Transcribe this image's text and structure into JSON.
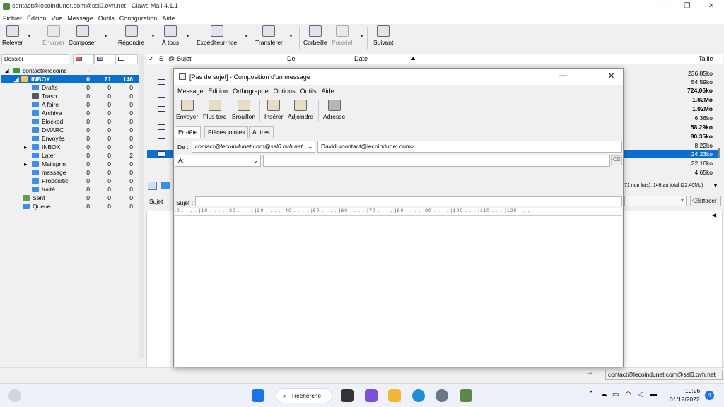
{
  "window": {
    "title": "contact@lecoindunet.com@ssl0.ovh.net - Claws Mail 4.1.1"
  },
  "menubar": [
    "Fichier",
    "Édition",
    "Vue",
    "Message",
    "Outils",
    "Configuration",
    "Aide"
  ],
  "toolbar": {
    "relever": "Relever",
    "envoyer": "Envoyer",
    "composer": "Composer",
    "repondre": "Répondre",
    "a_tous": "À tous",
    "expediteur": "Expéditeur·rice",
    "transferer": "Transférer",
    "corbeille": "Corbeille",
    "pourriel": "Pourriel",
    "suivant": "Suivant"
  },
  "folder_header": {
    "dossier": "Dossier"
  },
  "folders": [
    {
      "name": "contact@lecoinc",
      "a": "-",
      "b": "-",
      "c": "-"
    },
    {
      "name": "INBOX",
      "a": "0",
      "b": "71",
      "c": "146"
    },
    {
      "name": "Drafts",
      "a": "0",
      "b": "0",
      "c": "0"
    },
    {
      "name": "Trash",
      "a": "0",
      "b": "0",
      "c": "0"
    },
    {
      "name": "A faire",
      "a": "0",
      "b": "0",
      "c": "0"
    },
    {
      "name": "Archive",
      "a": "0",
      "b": "0",
      "c": "0"
    },
    {
      "name": "Blocked",
      "a": "0",
      "b": "0",
      "c": "0"
    },
    {
      "name": "DMARC",
      "a": "0",
      "b": "0",
      "c": "0"
    },
    {
      "name": "Envoyés",
      "a": "0",
      "b": "0",
      "c": "0"
    },
    {
      "name": "INBOX",
      "a": "0",
      "b": "0",
      "c": "0"
    },
    {
      "name": "Later",
      "a": "0",
      "b": "0",
      "c": "2"
    },
    {
      "name": "Mailsprin",
      "a": "0",
      "b": "0",
      "c": "0"
    },
    {
      "name": "message",
      "a": "0",
      "b": "0",
      "c": "0"
    },
    {
      "name": "Propositic",
      "a": "0",
      "b": "0",
      "c": "0"
    },
    {
      "name": "traité",
      "a": "0",
      "b": "0",
      "c": "0"
    },
    {
      "name": "Sent",
      "a": "0",
      "b": "0",
      "c": "0"
    },
    {
      "name": "Queue",
      "a": "0",
      "b": "0",
      "c": "0"
    }
  ],
  "msg_header": {
    "s": "S",
    "att": "@",
    "sujet": "Sujet",
    "de": "De",
    "date": "Date",
    "taille": "Taille"
  },
  "messages": [
    {
      "size": "236.85ko"
    },
    {
      "size": "54.59ko"
    },
    {
      "size": "724.06ko"
    },
    {
      "size": "1.02Mo"
    },
    {
      "size": "1.02Mo"
    },
    {
      "size": "6.36ko"
    },
    {
      "size": "58.29ko"
    },
    {
      "size": "80.35ko"
    },
    {
      "size": "8.22ko"
    },
    {
      "size": "24.23ko"
    },
    {
      "size": "22.16ko"
    },
    {
      "size": "4.65ko"
    }
  ],
  "list_status": "71 non lu(s), 146 au total (22.40Mo)",
  "search": {
    "label": "Sujet",
    "clear": "Effacer"
  },
  "statusbar": {
    "account": "contact@lecoindunet.com@ssl0.ovh.net"
  },
  "compose": {
    "title": "[Pas de sujet] - Composition d'un message",
    "menu": [
      "Message",
      "Édition",
      "Orthographe",
      "Options",
      "Outils",
      "Aide"
    ],
    "toolbar": {
      "envoyer": "Envoyer",
      "plus_tard": "Plus tard",
      "brouillon": "Brouillon",
      "inserer": "Insérer",
      "adjoindre": "Adjoindre",
      "adresse": "Adresse"
    },
    "tabs": [
      "En-tête",
      "Pièces jointes",
      "Autres"
    ],
    "from_label": "De :",
    "from_account": "contact@lecoindunet.com@ssl0.ovh.net",
    "from_value": "David <contact@lecoindunet.com>",
    "to_label": "À:",
    "subject_label": "Sujet :",
    "ruler": "|0 . . . . |10 . . . . |20 . . . . |30 . . . . |40 . . . . |50 . . . . |60 . . . . |70 . . . . |80 . . . . |90 . . . . |100 . . . |110 . . . |120 . . ."
  },
  "taskbar": {
    "search": "Recherche",
    "time": "10:26",
    "date": "01/12/2022",
    "badge": "4"
  }
}
